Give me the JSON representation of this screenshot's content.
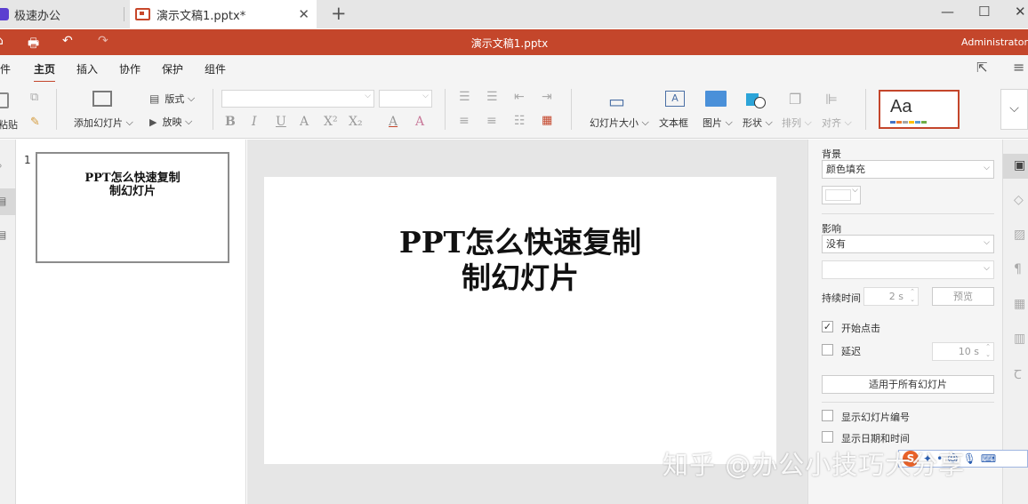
{
  "tabs": [
    {
      "label": "极速办公"
    },
    {
      "label": "演示文稿1.pptx*"
    }
  ],
  "titlebar": {
    "doc_title": "演示文稿1.pptx",
    "user": "Administrator"
  },
  "menu": {
    "file": "件",
    "home": "主页",
    "insert": "插入",
    "collaborate": "协作",
    "protect": "保护",
    "plugins": "组件"
  },
  "ribbon": {
    "paste": "粘贴",
    "add_slide": "添加幻灯片",
    "layout": "版式",
    "play": "放映",
    "slide_size": "幻灯片大小",
    "text_box": "文本框",
    "picture": "图片",
    "shape": "形状",
    "arrange": "排列",
    "align": "对齐",
    "theme_preview": "Aa"
  },
  "slide": {
    "number": "1",
    "title_line1": "PPT怎么快速复制",
    "title_line2": "制幻灯片"
  },
  "panel": {
    "background_label": "背景",
    "background_value": "颜色填充",
    "effect_label": "影响",
    "effect_value": "没有",
    "duration_label": "持续时间",
    "duration_value": "2 s",
    "preview_button": "预览",
    "start_on_click": "开始点击",
    "delay": "延迟",
    "delay_value": "10 s",
    "apply_all": "适用于所有幻灯片",
    "show_slide_number": "显示幻灯片编号",
    "show_date_time": "显示日期和时间"
  },
  "overlay": {
    "watermark": "知乎 @办公小技巧大分享",
    "ime_logo": "S"
  },
  "colors": {
    "accent": "#c4462b",
    "brand": "#5b3fd0",
    "theme_bars": [
      "#4472c4",
      "#ed7d31",
      "#a5a5a5",
      "#ffc000",
      "#5b9bd5",
      "#70ad47"
    ]
  }
}
